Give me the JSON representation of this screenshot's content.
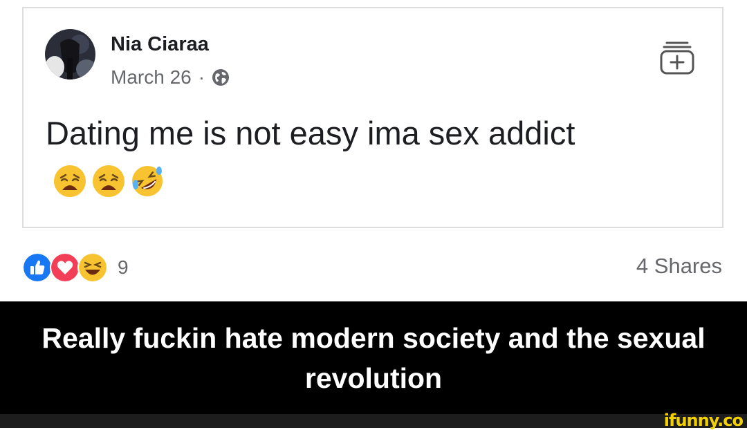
{
  "post": {
    "author_name": "Nia Ciaraa",
    "date": "March 26",
    "separator": "·",
    "privacy_icon": "globe-icon",
    "text": "Dating me is not easy ima sex addict",
    "emojis": [
      "weary-face-icon",
      "weary-face-icon",
      "rolling-on-floor-laughing-icon"
    ],
    "save_icon": "save-post-icon"
  },
  "engagement": {
    "reaction_icons": [
      "like-icon",
      "love-icon",
      "haha-icon"
    ],
    "reaction_count": "9",
    "shares": "4 Shares"
  },
  "caption": {
    "text": "Really fuckin hate modern society and the sexual revolution"
  },
  "watermark": {
    "text": "ifunny.co"
  },
  "colors": {
    "like_blue": "#1877f2",
    "love_red": "#f33e58",
    "emoji_yellow": "#f7c331",
    "watermark_yellow": "#f3d100",
    "secondary_text": "#65676b"
  }
}
